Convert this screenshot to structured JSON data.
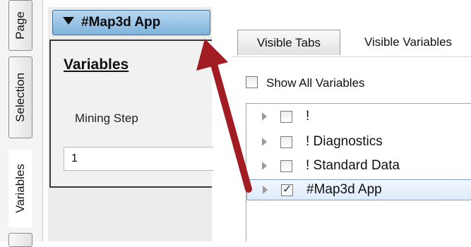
{
  "vtabs": [
    "Page",
    "Selection",
    "Variables"
  ],
  "app_button": {
    "label": "#Map3d App"
  },
  "variables_panel": {
    "title": "Variables",
    "field_label": "Mining Step",
    "field_value": "1"
  },
  "right_tabs": [
    "Visible Tabs",
    "Visible Variables"
  ],
  "show_all": {
    "label": "Show All Variables",
    "checked": false
  },
  "tree": [
    {
      "label": "!",
      "checked": false
    },
    {
      "label": "! Diagnostics",
      "checked": false
    },
    {
      "label": "! Standard Data",
      "checked": false
    },
    {
      "label": "#Map3d App",
      "checked": true
    }
  ],
  "colors": {
    "arrow": "#a11c23",
    "button": "#8fc0e6",
    "selection": "#dcebfc"
  }
}
